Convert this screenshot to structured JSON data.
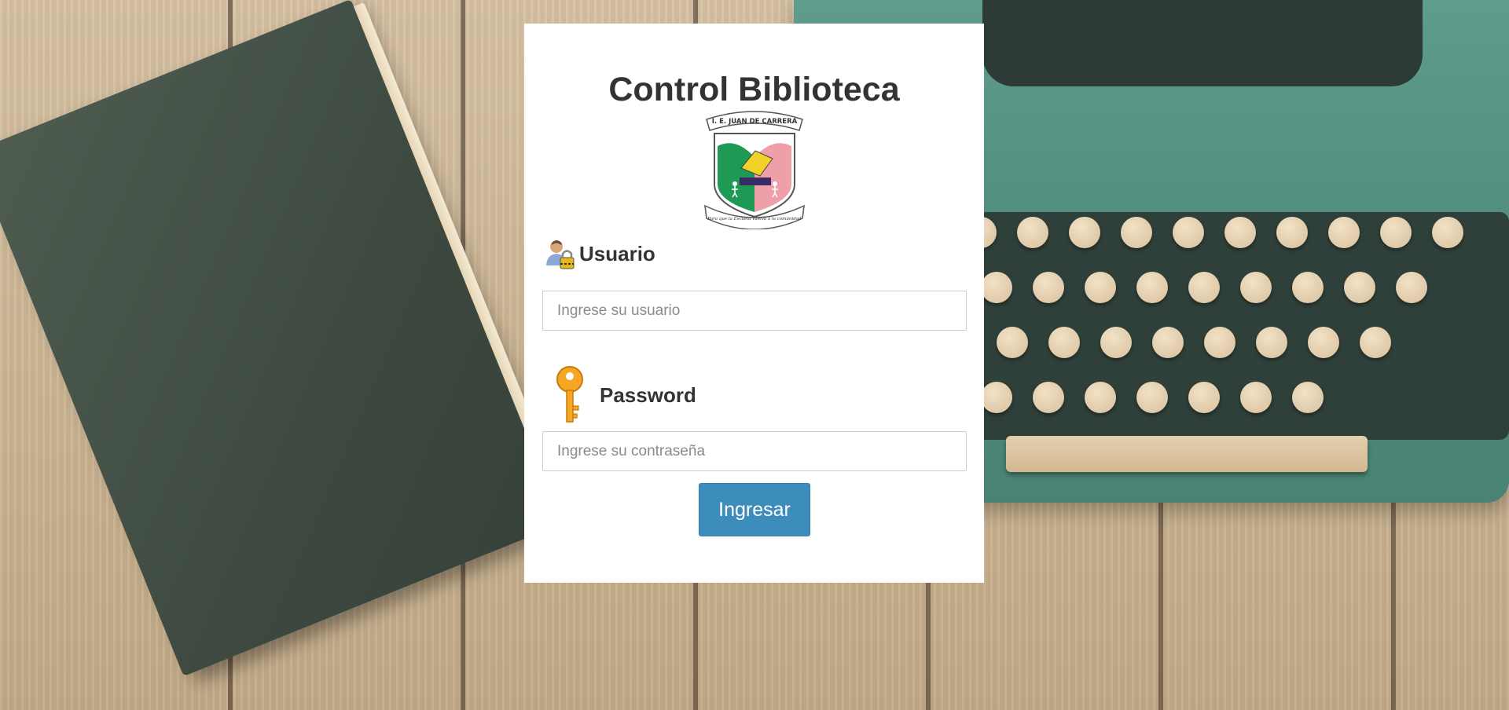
{
  "page": {
    "title": "Control Biblioteca"
  },
  "logo": {
    "banner_text": "I. E. JUAN DE CARRERA",
    "motto_text": "Para que la Escuela vuelva a la comunidad"
  },
  "form": {
    "user_label": "Usuario",
    "user_placeholder": "Ingrese su usuario",
    "user_value": "",
    "password_label": "Password",
    "password_placeholder": "Ingrese su contraseña",
    "password_value": "",
    "submit_label": "Ingresar"
  },
  "icons": {
    "user": "user-lock-icon",
    "password": "key-icon"
  },
  "colors": {
    "primary_button": "#3c8dbc",
    "title_text": "#333333",
    "card_background": "#ffffff"
  }
}
